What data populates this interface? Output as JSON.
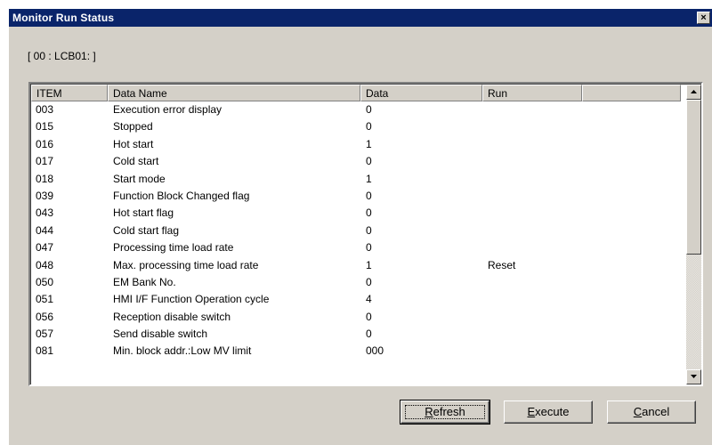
{
  "window": {
    "title": "Monitor Run Status",
    "close_label": "×"
  },
  "path_label": "[ 00 : LCB01: ]",
  "list": {
    "columns": [
      "ITEM",
      "Data Name",
      "Data",
      "Run"
    ],
    "rows": [
      {
        "item": "003",
        "name": "Execution error display",
        "data": "0",
        "run": ""
      },
      {
        "item": "015",
        "name": "Stopped",
        "data": "0",
        "run": ""
      },
      {
        "item": "016",
        "name": "Hot start",
        "data": "1",
        "run": ""
      },
      {
        "item": "017",
        "name": "Cold start",
        "data": "0",
        "run": ""
      },
      {
        "item": "018",
        "name": "Start mode",
        "data": "1",
        "run": ""
      },
      {
        "item": "039",
        "name": "Function Block Changed flag",
        "data": "0",
        "run": ""
      },
      {
        "item": "043",
        "name": "Hot start flag",
        "data": "0",
        "run": ""
      },
      {
        "item": "044",
        "name": "Cold start flag",
        "data": "0",
        "run": ""
      },
      {
        "item": "047",
        "name": "Processing time load rate",
        "data": "0",
        "run": ""
      },
      {
        "item": "048",
        "name": "Max. processing time load rate",
        "data": "1",
        "run": "Reset"
      },
      {
        "item": "050",
        "name": "EM Bank No.",
        "data": "0",
        "run": ""
      },
      {
        "item": "051",
        "name": "HMI I/F Function Operation cycle",
        "data": "4",
        "run": ""
      },
      {
        "item": "056",
        "name": "Reception disable switch",
        "data": "0",
        "run": ""
      },
      {
        "item": "057",
        "name": "Send disable switch",
        "data": "0",
        "run": ""
      },
      {
        "item": "081",
        "name": "Min. block addr.:Low MV limit",
        "data": "000",
        "run": ""
      }
    ]
  },
  "buttons": {
    "refresh": {
      "mnemonic": "R",
      "rest": "efresh"
    },
    "execute": {
      "mnemonic": "E",
      "rest": "xecute"
    },
    "cancel": {
      "mnemonic": "C",
      "rest": "ancel"
    }
  },
  "icons": {
    "scroll_up": "arrow-up-icon",
    "scroll_down": "arrow-down-icon"
  },
  "colors": {
    "titlebar": "#0a246a",
    "face": "#d4d0c8"
  }
}
